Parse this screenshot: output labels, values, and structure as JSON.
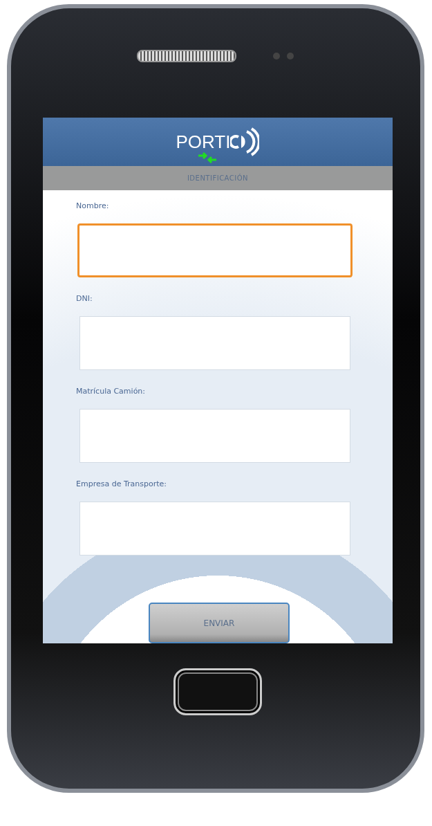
{
  "header": {
    "logo_text": "PORTI"
  },
  "title_bar": {
    "title": "IDENTIFICACIÓN"
  },
  "form": {
    "fields": [
      {
        "label": "Nombre:",
        "focused": true
      },
      {
        "label": "DNI:",
        "focused": false
      },
      {
        "label": "Matrícula Camión:",
        "focused": false
      },
      {
        "label": "Empresa de Transporte:",
        "focused": false
      }
    ]
  },
  "submit_button": {
    "label": "ENVIAR"
  }
}
